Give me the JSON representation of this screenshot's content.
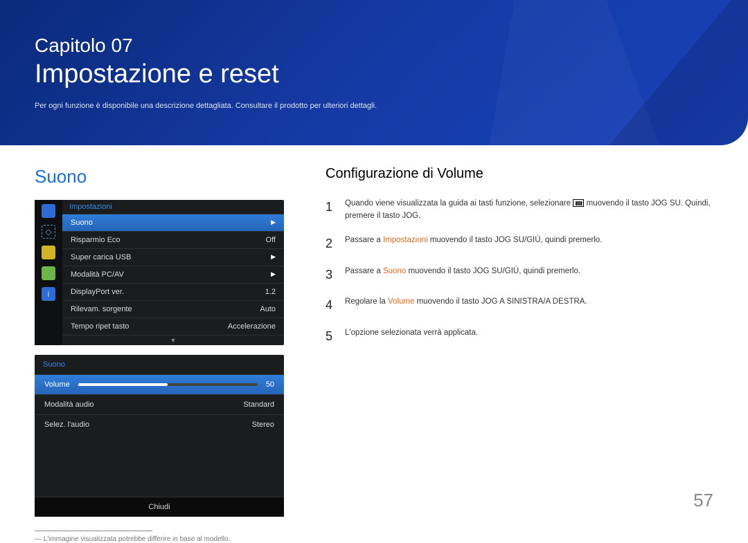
{
  "banner": {
    "chapter_label": "Capitolo 07",
    "chapter_title": "Impostazione e reset",
    "subtitle": "Per ogni funzione è disponibile una descrizione dettagliata. Consultare il prodotto per ulteriori dettagli."
  },
  "left": {
    "section_heading": "Suono",
    "osd1": {
      "title": "Impostazioni",
      "rows": [
        {
          "label": "Suono",
          "value": "▶",
          "selected": true
        },
        {
          "label": "Risparmio Eco",
          "value": "Off"
        },
        {
          "label": "Super carica USB",
          "value": "▶"
        },
        {
          "label": "Modalità PC/AV",
          "value": "▶"
        },
        {
          "label": "DisplayPort ver.",
          "value": "1.2"
        },
        {
          "label": "Rilevam. sorgente",
          "value": "Auto"
        },
        {
          "label": "Tempo ripet tasto",
          "value": "Accelerazione"
        }
      ]
    },
    "osd2": {
      "title": "Suono",
      "volume_label": "Volume",
      "volume_value": "50",
      "rows": [
        {
          "label": "Modalità audio",
          "value": "Standard"
        },
        {
          "label": "Selez. l'audio",
          "value": "Stereo"
        }
      ],
      "close": "Chiudi"
    },
    "footnote": "L'immagine visualizzata potrebbe differire in base al modello."
  },
  "right": {
    "heading": "Configurazione di Volume",
    "steps": {
      "s1_a": "Quando viene visualizzata la guida ai tasti funzione, selezionare ",
      "s1_b": " muovendo il tasto JOG SU. Quindi, premere il tasto JOG.",
      "s2_a": "Passare a ",
      "s2_hl": "Impostazioni",
      "s2_b": " muovendo il tasto JOG SU/GIÙ, quindi premerlo.",
      "s3_a": "Passare a ",
      "s3_hl": "Suono",
      "s3_b": " muovendo il tasto JOG SU/GIÙ, quindi premerlo.",
      "s4_a": "Regolare la ",
      "s4_hl": "Volume",
      "s4_b": " muovendo il tasto JOG A SINISTRA/A DESTRA.",
      "s5": "L'opzione selezionata verrà applicata."
    }
  },
  "page_number": "57"
}
